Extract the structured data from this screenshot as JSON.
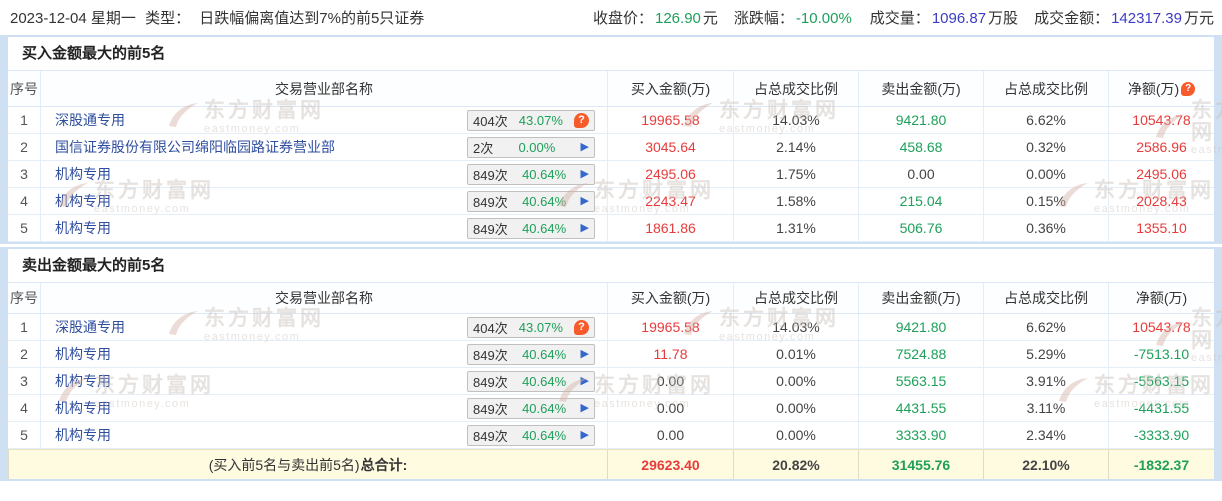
{
  "colors": {
    "up_red": "#e83b3b",
    "down_green": "#1ea05a",
    "link_blue": "#2f4e9e",
    "value_blue": "#3c3cc4",
    "frame_blue": "#cfe0f3",
    "footer_yellow": "#fffbe1",
    "help_orange": "#f75b2c",
    "arrow_blue": "#3568cc"
  },
  "header": {
    "date": "2023-12-04 星期一",
    "type_label": "类型：",
    "type_value": "日跌幅偏离值达到7%的前5只证券",
    "stats": [
      {
        "label": "收盘价：",
        "value": "126.90",
        "unit": "元",
        "color": "green"
      },
      {
        "label": "涨跌幅：",
        "value": "-10.00%",
        "unit": "",
        "color": "green"
      },
      {
        "label": "成交量：",
        "value": "1096.87",
        "unit": "万股",
        "color": "blue"
      },
      {
        "label": "成交金额：",
        "value": "142317.39",
        "unit": "万元",
        "color": "blue"
      }
    ]
  },
  "columns": {
    "no": "序号",
    "name": "交易营业部名称",
    "nums": [
      "买入金额(万)",
      "占总成交比例",
      "卖出金额(万)",
      "占总成交比例",
      "净额(万)"
    ]
  },
  "tables": [
    {
      "title": "买入金额最大的前5名",
      "net_help_icon": true,
      "rows": [
        {
          "no": "1",
          "name": "深股通专用",
          "times": "404次",
          "ratio": "43.07%",
          "icon": "help",
          "cells": [
            [
              "19965.58",
              "red"
            ],
            [
              "14.03%",
              "dark"
            ],
            [
              "9421.80",
              "green"
            ],
            [
              "6.62%",
              "dark"
            ],
            [
              "10543.78",
              "red"
            ]
          ]
        },
        {
          "no": "2",
          "name": "国信证券股份有限公司绵阳临园路证券营业部",
          "times": "2次",
          "ratio": "0.00%",
          "icon": "arrow",
          "cells": [
            [
              "3045.64",
              "red"
            ],
            [
              "2.14%",
              "dark"
            ],
            [
              "458.68",
              "green"
            ],
            [
              "0.32%",
              "dark"
            ],
            [
              "2586.96",
              "red"
            ]
          ]
        },
        {
          "no": "3",
          "name": "机构专用",
          "times": "849次",
          "ratio": "40.64%",
          "icon": "arrow",
          "cells": [
            [
              "2495.06",
              "red"
            ],
            [
              "1.75%",
              "dark"
            ],
            [
              "0.00",
              "dark"
            ],
            [
              "0.00%",
              "dark"
            ],
            [
              "2495.06",
              "red"
            ]
          ]
        },
        {
          "no": "4",
          "name": "机构专用",
          "times": "849次",
          "ratio": "40.64%",
          "icon": "arrow",
          "cells": [
            [
              "2243.47",
              "red"
            ],
            [
              "1.58%",
              "dark"
            ],
            [
              "215.04",
              "green"
            ],
            [
              "0.15%",
              "dark"
            ],
            [
              "2028.43",
              "red"
            ]
          ]
        },
        {
          "no": "5",
          "name": "机构专用",
          "times": "849次",
          "ratio": "40.64%",
          "icon": "arrow",
          "cells": [
            [
              "1861.86",
              "red"
            ],
            [
              "1.31%",
              "dark"
            ],
            [
              "506.76",
              "green"
            ],
            [
              "0.36%",
              "dark"
            ],
            [
              "1355.10",
              "red"
            ]
          ]
        }
      ]
    },
    {
      "title": "卖出金额最大的前5名",
      "net_help_icon": false,
      "rows": [
        {
          "no": "1",
          "name": "深股通专用",
          "times": "404次",
          "ratio": "43.07%",
          "icon": "help",
          "cells": [
            [
              "19965.58",
              "red"
            ],
            [
              "14.03%",
              "dark"
            ],
            [
              "9421.80",
              "green"
            ],
            [
              "6.62%",
              "dark"
            ],
            [
              "10543.78",
              "red"
            ]
          ]
        },
        {
          "no": "2",
          "name": "机构专用",
          "times": "849次",
          "ratio": "40.64%",
          "icon": "arrow",
          "cells": [
            [
              "11.78",
              "red"
            ],
            [
              "0.01%",
              "dark"
            ],
            [
              "7524.88",
              "green"
            ],
            [
              "5.29%",
              "dark"
            ],
            [
              "-7513.10",
              "green"
            ]
          ]
        },
        {
          "no": "3",
          "name": "机构专用",
          "times": "849次",
          "ratio": "40.64%",
          "icon": "arrow",
          "cells": [
            [
              "0.00",
              "dark"
            ],
            [
              "0.00%",
              "dark"
            ],
            [
              "5563.15",
              "green"
            ],
            [
              "3.91%",
              "dark"
            ],
            [
              "-5563.15",
              "green"
            ]
          ]
        },
        {
          "no": "4",
          "name": "机构专用",
          "times": "849次",
          "ratio": "40.64%",
          "icon": "arrow",
          "cells": [
            [
              "0.00",
              "dark"
            ],
            [
              "0.00%",
              "dark"
            ],
            [
              "4431.55",
              "green"
            ],
            [
              "3.11%",
              "dark"
            ],
            [
              "-4431.55",
              "green"
            ]
          ]
        },
        {
          "no": "5",
          "name": "机构专用",
          "times": "849次",
          "ratio": "40.64%",
          "icon": "arrow",
          "cells": [
            [
              "0.00",
              "dark"
            ],
            [
              "0.00%",
              "dark"
            ],
            [
              "3333.90",
              "green"
            ],
            [
              "2.34%",
              "dark"
            ],
            [
              "-3333.90",
              "green"
            ]
          ]
        }
      ],
      "footer": {
        "label_normal": "(买入前5名与卖出前5名)",
        "label_bold": "总合计:",
        "cells": [
          [
            "29623.40",
            "red"
          ],
          [
            "20.82%",
            "dark"
          ],
          [
            "31455.76",
            "green"
          ],
          [
            "22.10%",
            "dark"
          ],
          [
            "-1832.37",
            "green"
          ]
        ]
      }
    }
  ],
  "watermark": {
    "line1": "东方财富网",
    "line2": "eastmoney.com"
  }
}
